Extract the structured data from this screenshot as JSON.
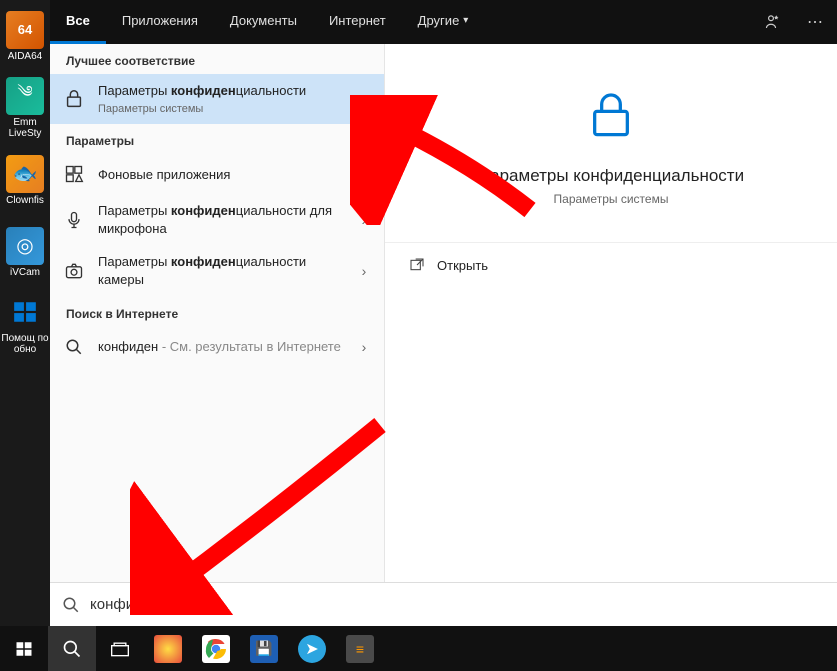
{
  "desktop": {
    "items": [
      {
        "label": "AIDA64",
        "badge": "64"
      },
      {
        "label": "Emm LiveSty",
        "badge": ""
      },
      {
        "label": "Clownfis",
        "badge": ""
      },
      {
        "label": "iVCam",
        "badge": ""
      },
      {
        "label": "Помощ по обно",
        "badge": ""
      }
    ]
  },
  "tabs": {
    "items": [
      "Все",
      "Приложения",
      "Документы",
      "Интернет",
      "Другие"
    ]
  },
  "results": {
    "best_match_header": "Лучшее соответствие",
    "best": {
      "title_prefix": "Параметры ",
      "title_bold": "конфиден",
      "title_suffix": "циальности",
      "subtitle": "Параметры системы"
    },
    "settings_header": "Параметры",
    "settings": [
      {
        "prefix": "Фоновые приложения",
        "bold": "",
        "suffix": ""
      },
      {
        "prefix": "Параметры ",
        "bold": "конфиден",
        "suffix": "циальности для микрофона"
      },
      {
        "prefix": "Параметры ",
        "bold": "конфиден",
        "suffix": "циальности камеры"
      }
    ],
    "web_header": "Поиск в Интернете",
    "web": {
      "term": "конфиден",
      "hint": " - См. результаты в Интернете"
    }
  },
  "preview": {
    "title": "Параметры конфиденциальности",
    "subtitle": "Параметры системы",
    "open_label": "Открыть"
  },
  "search": {
    "value": "конфиден"
  }
}
